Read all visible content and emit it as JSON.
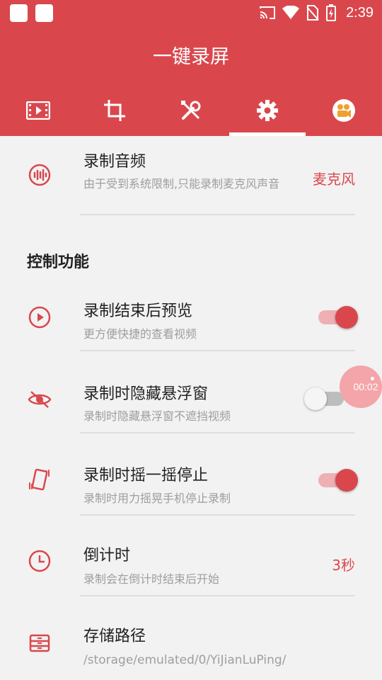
{
  "status_bar": {
    "time": "2:39"
  },
  "app": {
    "title": "一键录屏"
  },
  "tabs": [
    {
      "icon": "video-film-icon",
      "active": false
    },
    {
      "icon": "crop-icon",
      "active": false
    },
    {
      "icon": "tools-icon",
      "active": false
    },
    {
      "icon": "gear-icon",
      "active": true
    },
    {
      "icon": "camera-app-icon",
      "active": false
    }
  ],
  "settings": {
    "audio": {
      "title": "录制音频",
      "subtitle": "由于受到系统限制,只能录制麦克风声音",
      "value": "麦克风"
    },
    "section_title": "控制功能",
    "preview": {
      "title": "录制结束后预览",
      "subtitle": "更方便快捷的查看视频",
      "enabled": true
    },
    "hide_window": {
      "title": "录制时隐藏悬浮窗",
      "subtitle": "录制时隐藏悬浮窗不遮挡视频",
      "enabled": false
    },
    "shake_stop": {
      "title": "录制时摇一摇停止",
      "subtitle": "录制时用力摇晃手机停止录制",
      "enabled": true
    },
    "countdown": {
      "title": "倒计时",
      "subtitle": "录制会在倒计时结束后开始",
      "value": "3秒"
    },
    "storage": {
      "title": "存储路径",
      "subtitle": "/storage/emulated/0/YiJianLuPing/"
    }
  },
  "floating_timer": "00:02",
  "colors": {
    "accent": "#d9474d",
    "background": "#f2f2f2",
    "switch_track_on": "#eeb0b3"
  }
}
